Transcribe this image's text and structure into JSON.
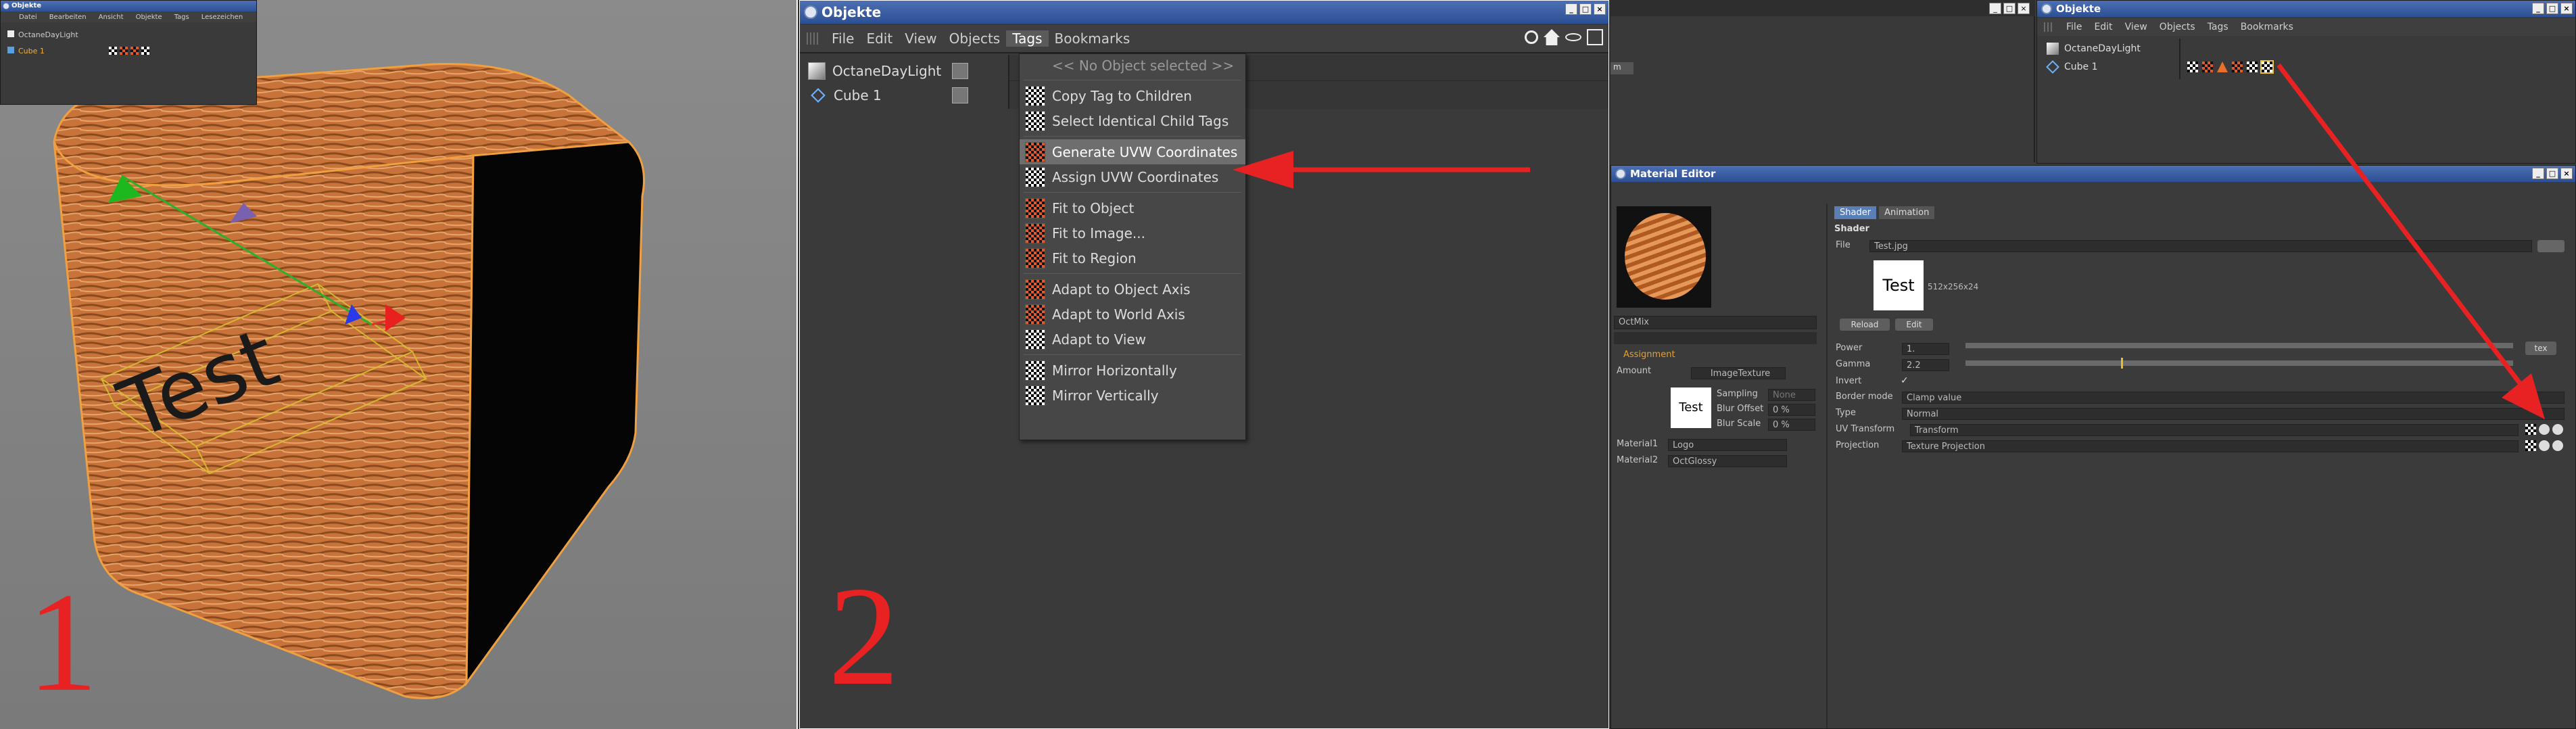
{
  "panel1": {
    "number_label": "1",
    "mini_window": {
      "title": "Objekte",
      "menu": [
        "Datei",
        "Bearbeiten",
        "Ansicht",
        "Objekte",
        "Tags",
        "Lesezeichen"
      ],
      "objects": [
        "OctaneDayLight",
        "Cube 1"
      ]
    },
    "projection_text": "Test"
  },
  "panel2": {
    "number_label": "2",
    "window_title": "Objekte",
    "menu": [
      "Edit",
      "View",
      "Objects",
      "Tags",
      "Bookmarks"
    ],
    "menu_file": "File",
    "objects": [
      "OctaneDayLight",
      "Cube 1"
    ],
    "tags_menu": {
      "header": "<< No Object selected >>",
      "groups": [
        [
          "Copy Tag to Children",
          "Select Identical Child Tags"
        ],
        [
          "Generate UVW Coordinates",
          "Assign UVW Coordinates"
        ],
        [
          "Fit to Object",
          "Fit to Image...",
          "Fit to Region"
        ],
        [
          "Adapt to Object Axis",
          "Adapt to World Axis",
          "Adapt to View"
        ],
        [
          "Mirror Horizontally",
          "Mirror Vertically"
        ]
      ],
      "highlighted": "Generate UVW Coordinates"
    }
  },
  "panel3": {
    "partial_button": "m",
    "objects_window": {
      "title": "Objekte",
      "menu": [
        "File",
        "Edit",
        "View",
        "Objects",
        "Tags",
        "Bookmarks"
      ],
      "objects": [
        "OctaneDayLight",
        "Cube 1"
      ]
    },
    "material_editor": {
      "title": "Material Editor",
      "material_name": "OctMix",
      "tabs": [
        "Shader",
        "Animation"
      ],
      "section": "Shader",
      "file_label": "File",
      "file_value": "Test.jpg",
      "preview_text": "Test",
      "image_info": "512x256x24",
      "reload": "Reload",
      "edit": "Edit",
      "power_label": "Power",
      "power_value": "1.",
      "power_btn": "tex",
      "gamma_label": "Gamma",
      "gamma_value": "2.2",
      "invert_label": "Invert",
      "border_label": "Border mode",
      "border_value": "Clamp value",
      "type_label": "Type",
      "type_value": "Normal",
      "uvt_label": "UV Transform",
      "uvt_value": "Transform",
      "proj_label": "Projection",
      "proj_value": "Texture Projection",
      "assignment": "Assignment",
      "amount_label": "Amount",
      "amount_value": "ImageTexture",
      "sampling_label": "Sampling",
      "sampling_value": "None",
      "bluroff_label": "Blur Offset",
      "bluroff_value": "0 %",
      "blurscale_label": "Blur Scale",
      "blurscale_value": "0 %",
      "mat1_label": "Material1",
      "mat1_value": "Logo",
      "mat2_label": "Material2",
      "mat2_value": "OctGlossy"
    }
  },
  "colors": {
    "accent_red": "#e82222",
    "title_blue": "#2d4f93",
    "wood": "#c8733a"
  }
}
